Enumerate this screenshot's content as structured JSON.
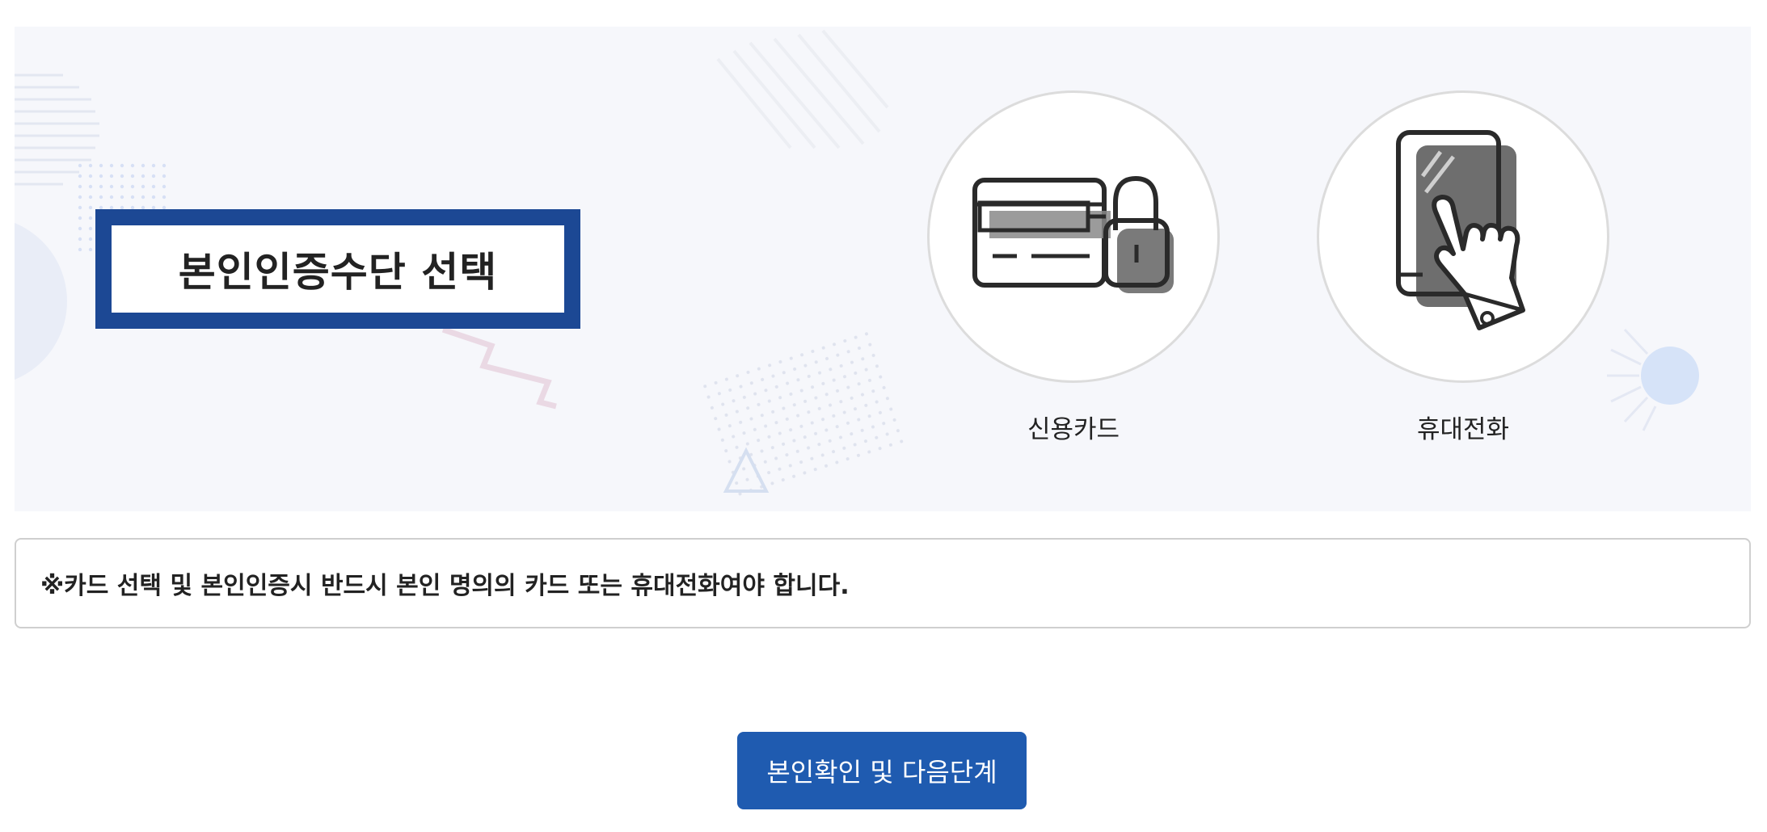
{
  "selection_panel": {
    "title": "본인인증수단 선택",
    "methods": [
      {
        "label": "신용카드",
        "icon": "credit-card-lock-icon"
      },
      {
        "label": "휴대전화",
        "icon": "smartphone-tap-icon"
      }
    ]
  },
  "notice": {
    "text": "※카드 선택 및 본인인증시 반드시 본인 명의의 카드 또는 휴대전화여야 합니다."
  },
  "actions": {
    "next_label": "본인확인 및 다음단계"
  },
  "colors": {
    "title_border": "#1c4894",
    "button_bg": "#1f5bb0",
    "panel_bg": "#f6f7fb"
  }
}
